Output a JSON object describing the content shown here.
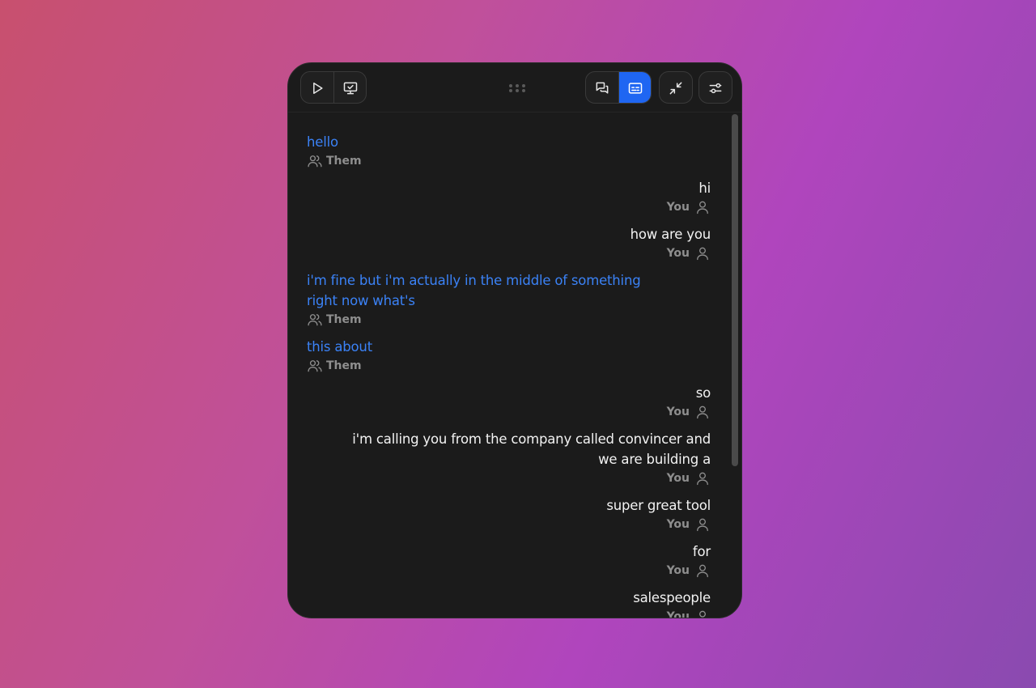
{
  "toolbar": {
    "left": [
      {
        "name": "play-button",
        "icon": "play-icon"
      },
      {
        "name": "screen-share-button",
        "icon": "monitor-check-icon"
      }
    ],
    "view_toggle": [
      {
        "name": "chat-view-button",
        "icon": "chat-bubbles-icon",
        "active": false
      },
      {
        "name": "captions-view-button",
        "icon": "captions-icon",
        "active": true
      }
    ],
    "minimize": {
      "icon": "minimize-arrows-icon"
    },
    "settings": {
      "icon": "sliders-icon"
    },
    "drag_handle": {
      "icon": "drag-dots-icon"
    },
    "active_color": "#1f66f2"
  },
  "colors": {
    "them_text": "#3b82f6",
    "you_text": "#f2f2f2",
    "speaker_label": "#8e8e8e",
    "panel_bg": "#1b1b1b"
  },
  "messages": [
    {
      "speaker": "them",
      "label": "Them",
      "text": "hello"
    },
    {
      "speaker": "you",
      "label": "You",
      "text": "hi"
    },
    {
      "speaker": "you",
      "label": "You",
      "text": "how are you"
    },
    {
      "speaker": "them",
      "label": "Them",
      "text": "i'm fine but i'm actually in the middle of something right now what's"
    },
    {
      "speaker": "them",
      "label": "Them",
      "text": "this about"
    },
    {
      "speaker": "you",
      "label": "You",
      "text": "so"
    },
    {
      "speaker": "you",
      "label": "You",
      "text": "i'm calling you from the company called convincer and we are building a"
    },
    {
      "speaker": "you",
      "label": "You",
      "text": "super great tool"
    },
    {
      "speaker": "you",
      "label": "You",
      "text": "for"
    },
    {
      "speaker": "you",
      "label": "You",
      "text": "salespeople"
    }
  ]
}
